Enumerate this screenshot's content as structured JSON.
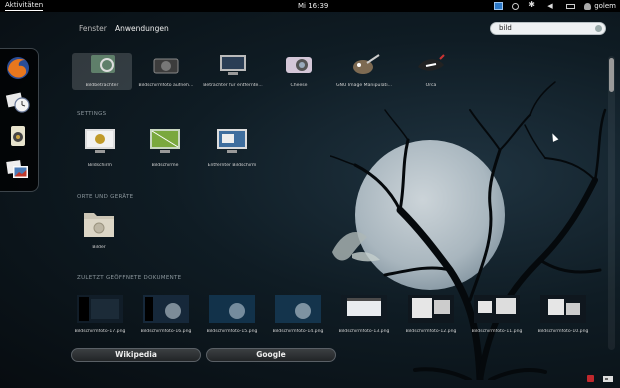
{
  "topbar": {
    "activities": "Aktivitäten",
    "clock": "Mi 16:39",
    "user": "golem"
  },
  "tabs": {
    "windows": "Fenster",
    "applications": "Anwendungen"
  },
  "search": {
    "value": "bild"
  },
  "sections": {
    "settings": "SETTINGS",
    "places": "ORTE UND GERÄTE",
    "recent": "ZULETZT GEÖFFNETE DOKUMENTE"
  },
  "apps": [
    {
      "label": "Bildbetrachter",
      "icon": "image-viewer-icon"
    },
    {
      "label": "Bildschirmfoto aufneh...",
      "icon": "screenshot-icon"
    },
    {
      "label": "Betrachter für entfernte...",
      "icon": "remote-viewer-icon"
    },
    {
      "label": "Cheese",
      "icon": "cheese-webcam-icon"
    },
    {
      "label": "GNU Image Manipulati...",
      "icon": "gimp-icon"
    },
    {
      "label": "Orca",
      "icon": "orca-icon"
    }
  ],
  "settings_items": [
    {
      "label": "Bildschirm",
      "icon": "screen-settings-icon"
    },
    {
      "label": "Bildschirme",
      "icon": "displays-icon"
    },
    {
      "label": "Entfernter Bildschirm",
      "icon": "remote-desktop-icon"
    }
  ],
  "places": [
    {
      "label": "Bilder",
      "icon": "pictures-folder-icon"
    }
  ],
  "recent": [
    {
      "label": "Bildschirmfoto-17.png"
    },
    {
      "label": "Bildschirmfoto-16.png"
    },
    {
      "label": "Bildschirmfoto-15.png"
    },
    {
      "label": "Bildschirmfoto-14.png"
    },
    {
      "label": "Bildschirmfoto-13.png"
    },
    {
      "label": "Bildschirmfoto-12.png"
    },
    {
      "label": "Bildschirmfoto-11.png"
    },
    {
      "label": "Bildschirmfoto-10.png"
    }
  ],
  "search_providers": {
    "wikipedia": "Wikipedia",
    "google": "Google"
  },
  "dash": [
    "firefox-icon",
    "mail-clock-icon",
    "speaker-icon",
    "photos-icon"
  ]
}
